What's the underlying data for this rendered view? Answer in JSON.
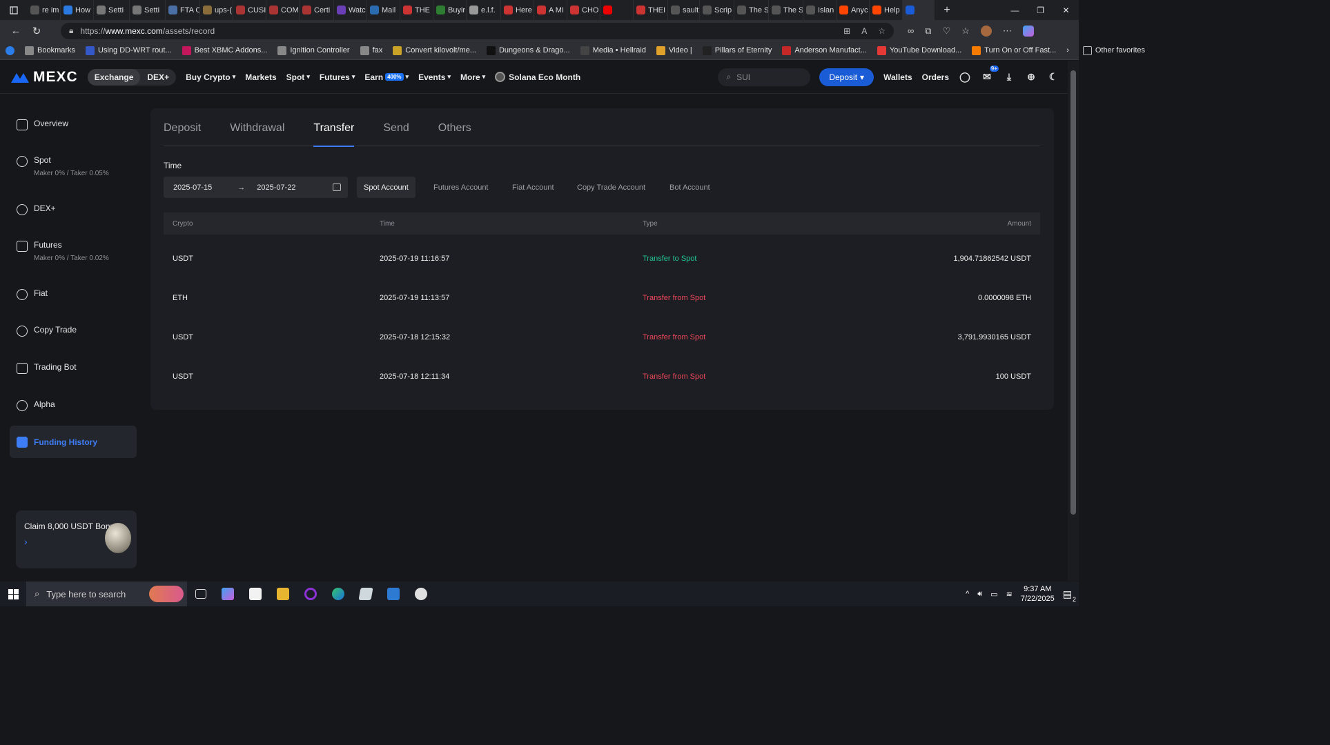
{
  "browser": {
    "tabs": [
      {
        "label": "re im",
        "color": "#555"
      },
      {
        "label": "How",
        "color": "#2a7ae2"
      },
      {
        "label": "Setti",
        "color": "#777"
      },
      {
        "label": "Setti",
        "color": "#777"
      },
      {
        "label": "FTA C",
        "color": "#4a6fa5"
      },
      {
        "label": "ups-(",
        "color": "#8a6d3b"
      },
      {
        "label": "CUSI",
        "color": "#a33"
      },
      {
        "label": "COM",
        "color": "#a33"
      },
      {
        "label": "Certi",
        "color": "#a33"
      },
      {
        "label": "Watc",
        "color": "#6a3fb5"
      },
      {
        "label": "Mail",
        "color": "#2b6cb0"
      },
      {
        "label": "THE I",
        "color": "#c33"
      },
      {
        "label": "Buyir",
        "color": "#2e7d32"
      },
      {
        "label": "e.l.f.",
        "color": "#999"
      },
      {
        "label": "Here",
        "color": "#c33"
      },
      {
        "label": "A MI",
        "color": "#c33"
      },
      {
        "label": "CHO",
        "color": "#c33"
      },
      {
        "label": "",
        "color": "#e00"
      },
      {
        "label": "THEI",
        "color": "#c33"
      },
      {
        "label": "sault",
        "color": "#555"
      },
      {
        "label": "Scrip",
        "color": "#555"
      },
      {
        "label": "The S",
        "color": "#555"
      },
      {
        "label": "The S",
        "color": "#555"
      },
      {
        "label": "Islan",
        "color": "#555"
      },
      {
        "label": "Anyc",
        "color": "#ff4500"
      },
      {
        "label": "Help",
        "color": "#ff4500"
      },
      {
        "label": "",
        "color": "#1a5bd6"
      }
    ],
    "url_prefix": "https://",
    "url_domain": "www.mexc.com",
    "url_path": "/assets/record",
    "bookmarks": [
      {
        "label": "Bookmarks",
        "color": "#888"
      },
      {
        "label": "Using DD-WRT rout...",
        "color": "#3558c9"
      },
      {
        "label": "Best XBMC Addons...",
        "color": "#c2185b"
      },
      {
        "label": "Ignition Controller",
        "color": "#888"
      },
      {
        "label": "fax",
        "color": "#888"
      },
      {
        "label": "Convert kilovolt/me...",
        "color": "#c9a227"
      },
      {
        "label": "Dungeons & Drago...",
        "color": "#111"
      },
      {
        "label": "Media • Hellraid",
        "color": "#444"
      },
      {
        "label": "Video |",
        "color": "#e0a12a"
      },
      {
        "label": "Pillars of Eternity",
        "color": "#222"
      },
      {
        "label": "Anderson Manufact...",
        "color": "#c62828"
      },
      {
        "label": "YouTube Download...",
        "color": "#e53935"
      },
      {
        "label": "Turn On or Off Fast...",
        "color": "#f57c00"
      }
    ],
    "other_favorites": "Other favorites"
  },
  "nav": {
    "logo": "MEXC",
    "segment": [
      "Exchange",
      "DEX+"
    ],
    "menu": [
      {
        "label": "Buy Crypto",
        "caret": true
      },
      {
        "label": "Markets",
        "caret": false
      },
      {
        "label": "Spot",
        "caret": true
      },
      {
        "label": "Futures",
        "caret": true
      },
      {
        "label": "Earn",
        "caret": true,
        "badge": "400%"
      },
      {
        "label": "Events",
        "caret": true
      },
      {
        "label": "More",
        "caret": true
      }
    ],
    "promo_link": "Solana Eco Month",
    "search_placeholder": "SUI",
    "deposit": "Deposit",
    "wallets": "Wallets",
    "orders": "Orders",
    "notif_badge": "9+"
  },
  "sidebar": {
    "items": [
      {
        "label": "Overview",
        "sub": ""
      },
      {
        "label": "Spot",
        "sub": "Maker 0% / Taker 0.05%"
      },
      {
        "label": "DEX+",
        "sub": ""
      },
      {
        "label": "Futures",
        "sub": "Maker 0% / Taker 0.02%"
      },
      {
        "label": "Fiat",
        "sub": ""
      },
      {
        "label": "Copy Trade",
        "sub": ""
      },
      {
        "label": "Trading Bot",
        "sub": ""
      },
      {
        "label": "Alpha",
        "sub": ""
      },
      {
        "label": "Funding History",
        "sub": "",
        "active": true
      }
    ],
    "promo_title": "Claim 8,000 USDT Bonus"
  },
  "record": {
    "tabs": [
      "Deposit",
      "Withdrawal",
      "Transfer",
      "Send",
      "Others"
    ],
    "active_tab": "Transfer",
    "time_label": "Time",
    "date_from": "2025-07-15",
    "date_to": "2025-07-22",
    "accounts": [
      "Spot Account",
      "Futures Account",
      "Fiat Account",
      "Copy Trade Account",
      "Bot Account"
    ],
    "active_account": "Spot Account",
    "columns": {
      "crypto": "Crypto",
      "time": "Time",
      "type": "Type",
      "amount": "Amount"
    },
    "rows": [
      {
        "crypto": "USDT",
        "time": "2025-07-19 11:16:57",
        "type": "Transfer to Spot",
        "direction": "in",
        "amount": "1,904.71862542 USDT"
      },
      {
        "crypto": "ETH",
        "time": "2025-07-19 11:13:57",
        "type": "Transfer from Spot",
        "direction": "out",
        "amount": "0.0000098 ETH"
      },
      {
        "crypto": "USDT",
        "time": "2025-07-18 12:15:32",
        "type": "Transfer from Spot",
        "direction": "out",
        "amount": "3,791.9930165 USDT"
      },
      {
        "crypto": "USDT",
        "time": "2025-07-18 12:11:34",
        "type": "Transfer from Spot",
        "direction": "out",
        "amount": "100 USDT"
      }
    ]
  },
  "taskbar": {
    "search_placeholder": "Type here to search",
    "time": "9:37 AM",
    "date": "7/22/2025",
    "notif_count": "2"
  },
  "colors": {
    "accent": "#1a5bd6",
    "positive": "#22c995",
    "negative": "#f0475c"
  }
}
